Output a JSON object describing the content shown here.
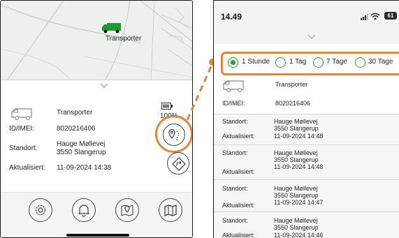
{
  "left_phone": {
    "map": {
      "vehicle_label": "Transporter"
    },
    "vehicle": {
      "name": "Transporter",
      "imei_label": "ID/IMEI:",
      "imei": "8020216406",
      "location_label": "Standort:",
      "location_line1": "Hauge Møllevej",
      "location_line2": "3550 Slangerup",
      "updated_label": "Aktualisiert:",
      "updated": "11-09-2024 14:38",
      "battery": "100%"
    },
    "bottom_nav": [
      "settings-icon",
      "bell-icon",
      "map-pin-icon",
      "map-icon"
    ]
  },
  "right_phone": {
    "status_bar": {
      "time": "14.49",
      "battery": "61"
    },
    "filter_options": [
      {
        "label": "1 Stunde",
        "selected": true
      },
      {
        "label": "1 Tag",
        "selected": false
      },
      {
        "label": "7 Tage",
        "selected": false
      },
      {
        "label": "30 Tage",
        "selected": false
      }
    ],
    "vehicle": {
      "name": "Transporter",
      "imei_label": "ID/IMEI:",
      "imei": "8020216406"
    },
    "history": [
      {
        "location_label": "Standort:",
        "line1": "Hauge Møllevej",
        "line2": "3550 Slangerup",
        "updated_label": "Aktualisiert:",
        "updated": "11-09-2024 14:48"
      },
      {
        "location_label": "Standort:",
        "line1": "Hauge Møllevej",
        "line2": "3550 Slangerup",
        "updated_label": "Aktualisiert:",
        "updated": "11-09-2024 14:48"
      },
      {
        "location_label": "Standort:",
        "line1": "Hauge Møllevej",
        "line2": "3550 Slangerup",
        "updated_label": "Aktualisiert:",
        "updated": "11-09-2024 14:47"
      },
      {
        "location_label": "Standort:",
        "line1": "Hauge Møllevej",
        "line2": "3550 Slangerup",
        "updated_label": "Aktualisiert:",
        "updated": "11-09-2024 14:46"
      }
    ]
  },
  "colors": {
    "accent": "#e8833a",
    "vehicle_green": "#1f9a2e",
    "radio_green": "#2e9c38"
  }
}
